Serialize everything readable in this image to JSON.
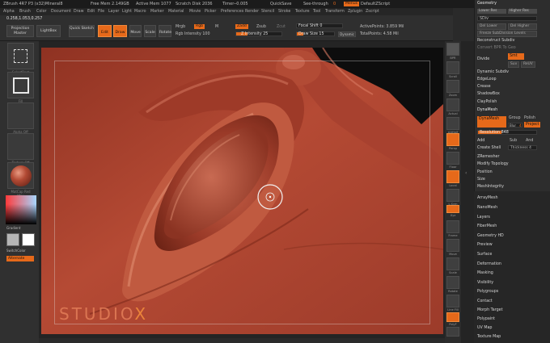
{
  "title": {
    "app": "ZBrush 4R7 P3 (x32)Mineral8",
    "free_mem": "Free Mem 2.149GB",
    "active_mem": "Active Mem 1077",
    "scratch_disk": "Scratch Disk 2036",
    "timer": "Timer─0.005",
    "quicksave": "QuickSave",
    "see_through": "See-through",
    "see_through_value": "0",
    "menus": "Menus",
    "default_zscript": "DefaultZScript"
  },
  "menubar": [
    "Alpha",
    "Brush",
    "Color",
    "Document",
    "Draw",
    "Edit",
    "File",
    "Layer",
    "Light",
    "Macro",
    "Marker",
    "Material",
    "Movie",
    "Picker",
    "Preferences",
    "Render",
    "Stencil",
    "Stroke",
    "Texture",
    "Tool",
    "Transform",
    "Zplugin",
    "Zscript"
  ],
  "shelf": {
    "projection_master": "Projection Master",
    "lightbox": "LightBox",
    "quick_sketch": "Quick Sketch",
    "edit": "Edit",
    "draw": "Draw",
    "move": "Move",
    "scale": "Scale",
    "rotate": "Rotate",
    "mrgb": "Mrgb",
    "rgb": "Rgb",
    "m": "M",
    "rgb_intensity": "Rgb Intensity 100",
    "zadd": "Zadd",
    "zsub": "Zsub",
    "zcut": "Zcut",
    "z_intensity": "Z Intensity 25",
    "focal_shift": "Focal Shift 0",
    "draw_size": "Draw Size 15",
    "dynamic": "Dynamic",
    "active_points": "ActivePoints: 3.859 Mil",
    "total_points": "TotalPoints: 4.58 Mil",
    "coords": "0.258,1.053,0.257"
  },
  "left_tray": {
    "slot_captions": [
      "SelectRect",
      "Fill",
      "Alpha Off",
      "Texture Off",
      "MatCap Red Wax"
    ],
    "gradient": "Gradient",
    "switch_color": "SwitchColor",
    "alternate": "Alternate"
  },
  "canvas": {
    "logo_text": "STUDIO",
    "logo_x": "X"
  },
  "right_shelf": [
    "BPR",
    "Scroll",
    "Zoom",
    "Actual",
    "AAHalf",
    "Persp",
    "Floor",
    "Local",
    "L.Sym",
    "Xyz",
    "Frame",
    "Move",
    "Scale",
    "Rotate",
    "Line Fill",
    "PolyF",
    "Transp",
    "Ghost",
    "Solo",
    "Xpose"
  ],
  "geometry_panel": {
    "header": "Geometry",
    "lower_res": "Lower Res",
    "higher_res": "Higher Res",
    "sdiv": "SDiv",
    "del_lower": "Del Lower",
    "del_higher": "Del Higher",
    "freeze_subdivision_levels": "Freeze SubDivision Levels",
    "reconstruct_subdiv": "Reconstruct Subdiv",
    "convert_bpr_to_geo": "Convert BPR To Geo",
    "divide": "Divide",
    "smt": "Smt",
    "suv": "Suv",
    "rsmt": "ReUV",
    "dynamic_subdiv": "Dynamic Subdiv",
    "edgeloop": "EdgeLoop",
    "crease": "Crease",
    "shadowbox": "ShadowBox",
    "claypolish": "ClayPolish",
    "dynamesh_header": "DynaMesh",
    "dynamesh_btn": "DynaMesh",
    "group": "Group",
    "polish": "Polish",
    "blur": "Blur",
    "blur_value": "4",
    "project": "Project",
    "resolution": "Resolution 848",
    "add": "Add",
    "sub": "Sub",
    "and": "And",
    "create_shell": "Create Shell",
    "thickness": "Thickness 4",
    "zremesher": "ZRemesher",
    "modify_topology": "Modify Topology",
    "position": "Position",
    "size": "Size",
    "meshintegrity": "MeshIntegrity"
  },
  "tool_subpalettes": [
    "ArrayMesh",
    "NanoMesh",
    "Layers",
    "FiberMesh",
    "Geometry HD",
    "Preview",
    "Surface",
    "Deformation",
    "Masking",
    "Visibility",
    "Polygroups",
    "Contact",
    "Morph Target",
    "Polypaint",
    "UV Map",
    "Texture Map"
  ],
  "colors": {
    "accent": "#e6691a",
    "clay": "#a8412f",
    "panel": "#2d2d2d"
  }
}
